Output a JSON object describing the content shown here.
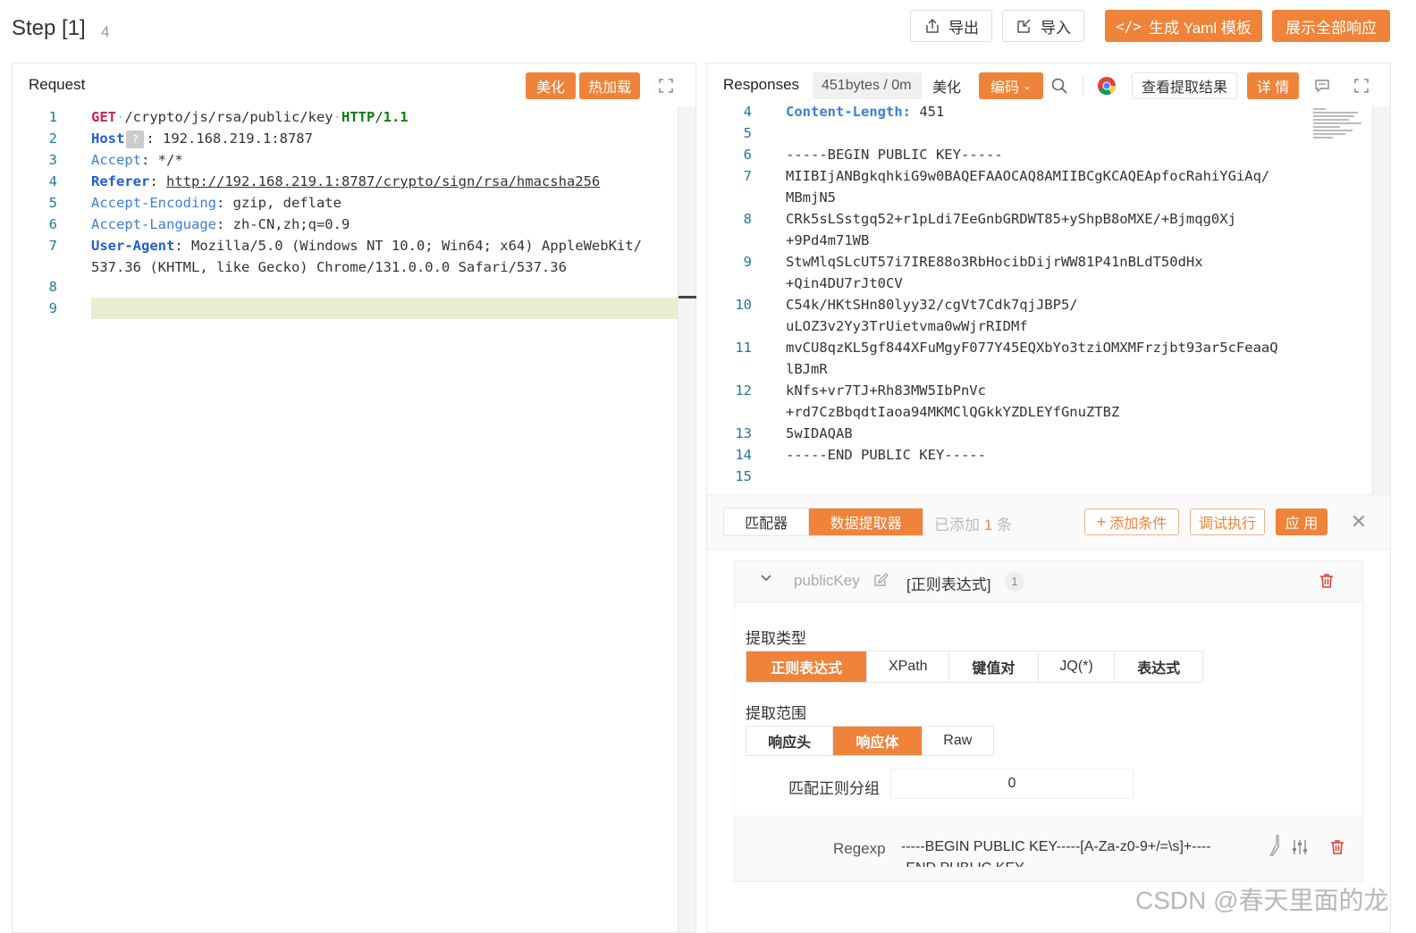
{
  "header": {
    "title": "Step [1]",
    "count": "4",
    "export_label": "导出",
    "import_label": "导入",
    "yaml_label": "生成 Yaml 模板",
    "show_all_label": "展示全部响应"
  },
  "request": {
    "title": "Request",
    "beautify_label": "美化",
    "hotload_label": "热加载",
    "lines": [
      {
        "n": "1"
      },
      {
        "n": "2"
      },
      {
        "n": "3"
      },
      {
        "n": "4"
      },
      {
        "n": "5"
      },
      {
        "n": "6"
      },
      {
        "n": "7"
      },
      {
        "n": "8"
      },
      {
        "n": "9"
      }
    ],
    "method": "GET",
    "path": "/crypto/js/rsa/public/key",
    "proto": "HTTP/1.1",
    "host_key": "Host",
    "host_val": ": 192.168.219.1:8787",
    "accept_key": "Accept",
    "accept_val": ": */*",
    "referer_key": "Referer",
    "referer_val": "http://192.168.219.1:8787/crypto/sign/rsa/hmacsha256",
    "enc_key": "Accept-Encoding",
    "enc_val": ": gzip, deflate",
    "lang_key": "Accept-Language",
    "lang_val": ": zh-CN,zh;q=0.9",
    "ua_key": "User-Agent",
    "ua_val1": ": Mozilla/5.0 (Windows NT 10.0; Win64; x64) AppleWebKit/",
    "ua_val2": "537.36 (KHTML, like Gecko) Chrome/131.0.0.0 Safari/537.36"
  },
  "response": {
    "title": "Responses",
    "size_label": "451bytes / 0m",
    "beautify_label": "美化",
    "encode_label": "编码",
    "view_extract_label": "查看提取结果",
    "detail_label": "详 情",
    "line_numbers": [
      "4",
      "5",
      "6",
      "7",
      "",
      "8",
      "",
      "9",
      "",
      "10",
      "",
      "11",
      "",
      "12",
      "",
      "13",
      "14",
      "15"
    ],
    "cl_key": "Content-Length:",
    "cl_val": " 451",
    "body_lines": [
      "",
      "-----BEGIN PUBLIC KEY-----",
      "MIIBIjANBgkqhkiG9w0BAQEFAAOCAQ8AMIIBCgKCAQEApfocRahiYGiAq/",
      "MBmjN5",
      "CRk5sLSstgq52+r1pLdi7EeGnbGRDWT85+yShpB8oMXE/+Bjmqg0Xj",
      "+9Pd4m71WB",
      "StwMlqSLcUT57i7IRE88o3RbHocibDijrWW81P41nBLdT50dHx",
      "+Qin4DU7rJt0CV",
      "C54k/HKtSHn80lyy32/cgVt7Cdk7qjJBP5/",
      "uLOZ3v2Yy3TrUietvma0wWjrRIDMf",
      "mvCU8qzKL5gf844XFuMgyF077Y45EQXbYo3tziOMXMFrzjbt93ar5cFeaaQ",
      "lBJmR",
      "kNfs+vr7TJ+Rh83MW5IbPnVc",
      "+rd7CzBbqdtIaoa94MKMClQGkkYZDLEYfGnuZTBZ",
      "5wIDAQAB",
      "-----END PUBLIC KEY-----",
      ""
    ]
  },
  "extractor": {
    "tab_matcher": "匹配器",
    "tab_extractor": "数据提取器",
    "added_prefix": "已添加",
    "added_count": "1",
    "added_suffix": "条",
    "add_condition": "添加条件",
    "debug_run": "调试执行",
    "apply": "应 用",
    "item_name": "publicKey",
    "item_type": "[正则表达式]",
    "item_badge": "1",
    "type_label": "提取类型",
    "types": [
      "正则表达式",
      "XPath",
      "键值对",
      "JQ(*)",
      "表达式"
    ],
    "scope_label": "提取范围",
    "scopes": [
      "响应头",
      "响应体",
      "Raw"
    ],
    "group_label": "匹配正则分组",
    "group_value": "0",
    "regexp_label": "Regexp",
    "regexp_value": "-----BEGIN PUBLIC KEY-----[A-Za-z0-9+/=\\s]+----",
    "regexp_value2": "-END PUBLIC KEY-----"
  },
  "watermark": "CSDN @春天里面的龙"
}
